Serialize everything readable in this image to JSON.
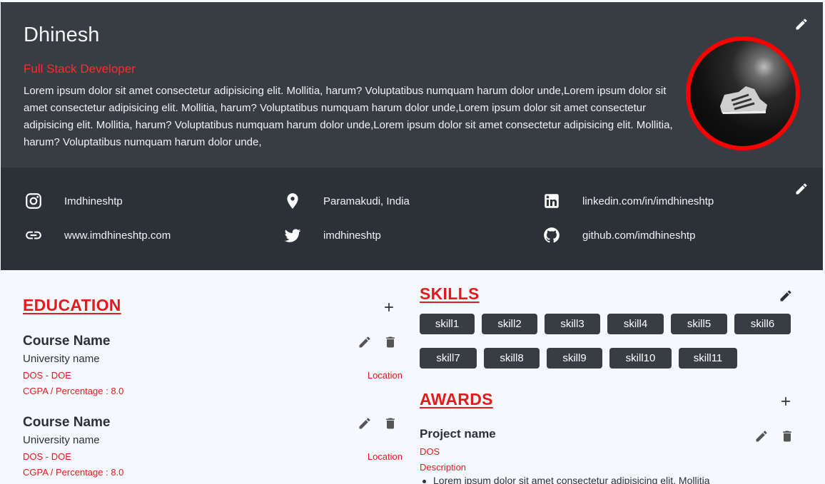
{
  "profile": {
    "name": "Dhinesh",
    "role": "Full Stack Developer",
    "bio": "Lorem ipsum dolor sit amet consectetur adipisicing elit. Mollitia, harum? Voluptatibus numquam harum dolor unde,Lorem ipsum dolor sit amet consectetur adipisicing elit. Mollitia, harum? Voluptatibus numquam harum dolor unde,Lorem ipsum dolor sit amet consectetur adipisicing elit. Mollitia, harum? Voluptatibus numquam harum dolor unde,Lorem ipsum dolor sit amet consectetur adipisicing elit. Mollitia, harum? Voluptatibus numquam harum dolor unde,"
  },
  "social": {
    "instagram": "Imdhineshtp",
    "location": "Paramakudi, India",
    "linkedin": "linkedin.com/in/imdhineshtp",
    "website": "www.imdhineshtp.com",
    "twitter": "imdhineshtp",
    "github": "github.com/imdhineshtp"
  },
  "education": {
    "title": "EDUCATION",
    "items": [
      {
        "course": "Course Name",
        "university": "University name",
        "dates": "DOS - DOE",
        "location": "Location",
        "cgpa": "CGPA / Percentage : 8.0"
      },
      {
        "course": "Course Name",
        "university": "University name",
        "dates": "DOS - DOE",
        "location": "Location",
        "cgpa": "CGPA / Percentage : 8.0"
      }
    ]
  },
  "skills": {
    "title": "SKILLS",
    "items": [
      "skill1",
      "skill2",
      "skill3",
      "skill4",
      "skill5",
      "skill6",
      "skill7",
      "skill8",
      "skill9",
      "skill10",
      "skill11"
    ]
  },
  "awards": {
    "title": "AWARDS",
    "items": [
      {
        "name": "Project name",
        "dos": "DOS",
        "description_label": "Description",
        "bullet": "Lorem ipsum dolor sit amet consectetur adipisicing elit. Mollitia"
      }
    ]
  },
  "colors": {
    "accent": "#e21c1c",
    "header_bg": "#383d44",
    "social_bg": "#2c3138",
    "avatar_border": "#ff0000"
  },
  "icons": [
    "edit-icon",
    "instagram-icon",
    "location-pin-icon",
    "linkedin-icon",
    "link-icon",
    "twitter-icon",
    "github-icon",
    "add-icon",
    "delete-icon"
  ]
}
